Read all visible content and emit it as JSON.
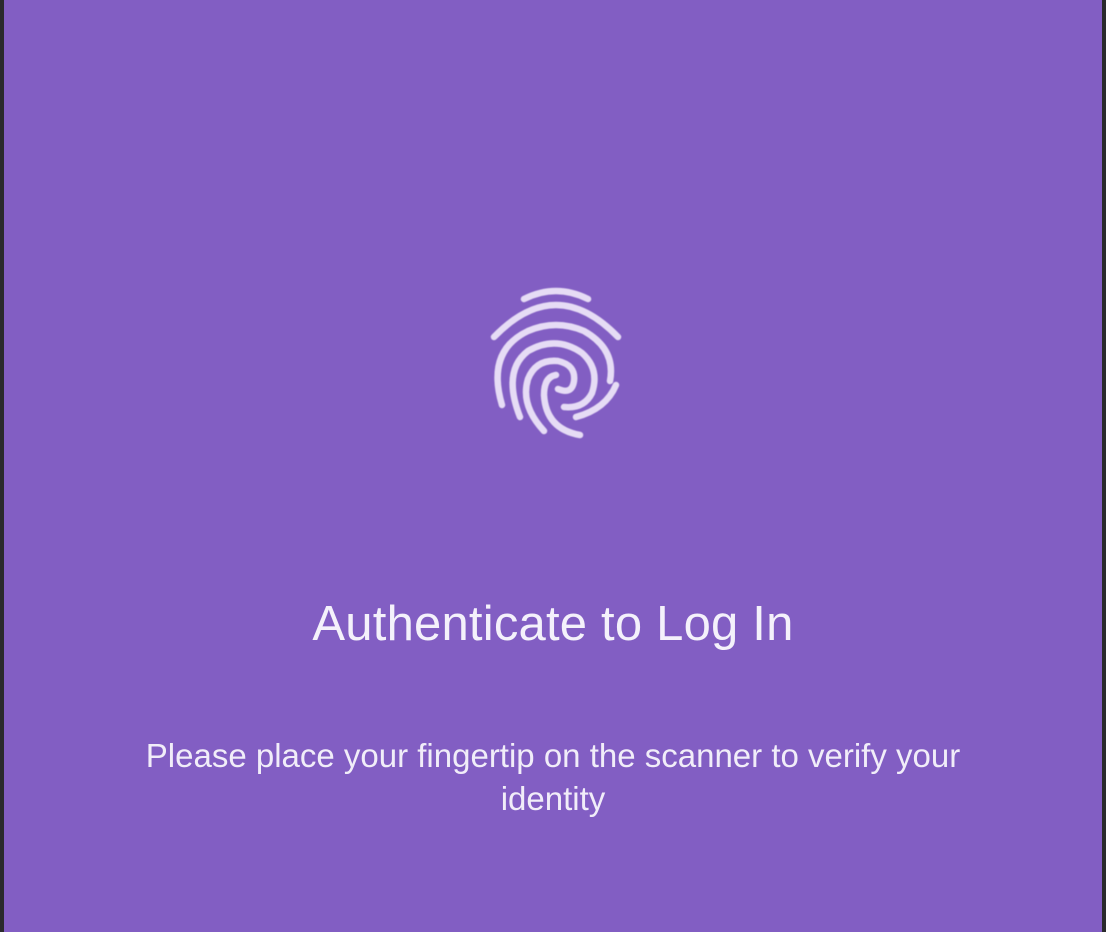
{
  "theme": {
    "background": "#825EC3",
    "icon_color": "#E6DCF5",
    "text_color": "#F4F1FB"
  },
  "auth": {
    "icon": "fingerprint-icon",
    "title": "Authenticate to Log In",
    "message": "Please place your fingertip on the scanner to verify your identity"
  }
}
